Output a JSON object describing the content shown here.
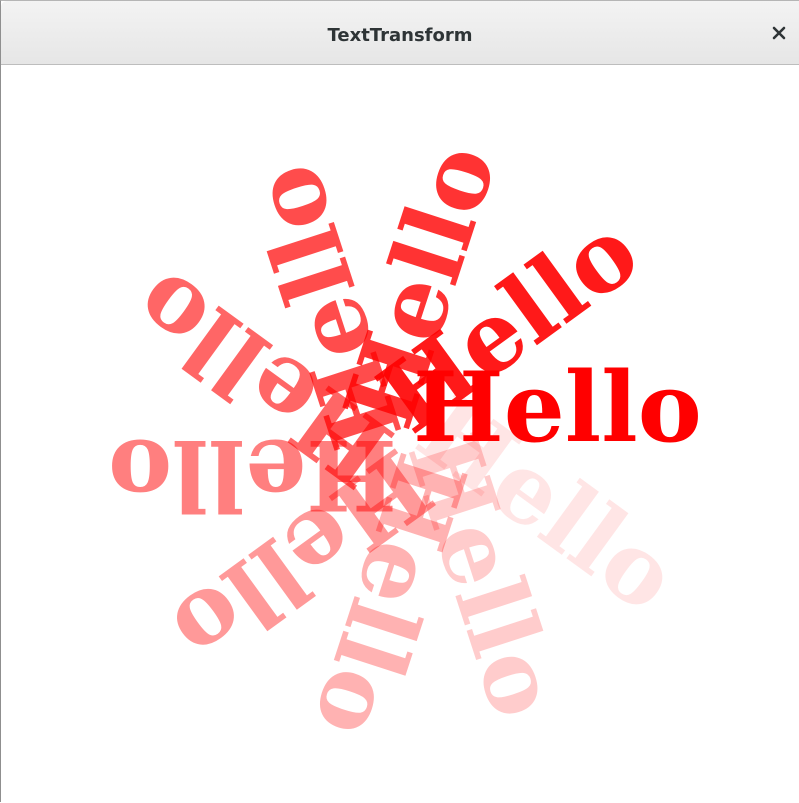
{
  "window": {
    "title": "TextTransform"
  },
  "canvas": {
    "text": "Hello",
    "color": "#ff0000",
    "copies": 10
  }
}
